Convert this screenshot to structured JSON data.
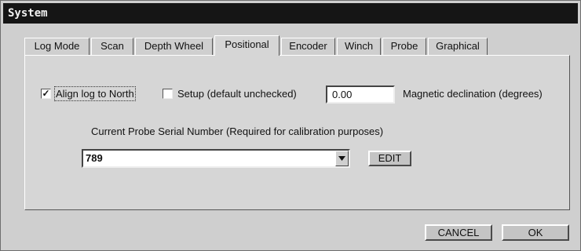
{
  "window": {
    "title": "System"
  },
  "tabs": [
    {
      "label": "Log Mode",
      "active": false
    },
    {
      "label": "Scan",
      "active": false
    },
    {
      "label": "Depth Wheel",
      "active": false
    },
    {
      "label": "Positional",
      "active": true
    },
    {
      "label": "Encoder",
      "active": false
    },
    {
      "label": "Winch",
      "active": false
    },
    {
      "label": "Probe",
      "active": false
    },
    {
      "label": "Graphical",
      "active": false
    }
  ],
  "positional": {
    "align_north": {
      "label": "Align log to North",
      "checked": true,
      "mark": "✓"
    },
    "setup": {
      "label": "Setup (default unchecked)",
      "checked": false,
      "mark": ""
    },
    "declination": {
      "value": "0.00",
      "label": "Magnetic declination (degrees)"
    },
    "serial": {
      "heading": "Current Probe Serial Number  (Required for calibration purposes)",
      "value": "789",
      "edit_label": "EDIT"
    }
  },
  "footer": {
    "cancel_label": "CANCEL",
    "ok_label": "OK"
  },
  "colors": {
    "titlebar": "#151515",
    "face": "#cfcfcf"
  },
  "icons": {
    "combo_arrow": "triangle-down-icon",
    "check": "checkmark-icon"
  }
}
